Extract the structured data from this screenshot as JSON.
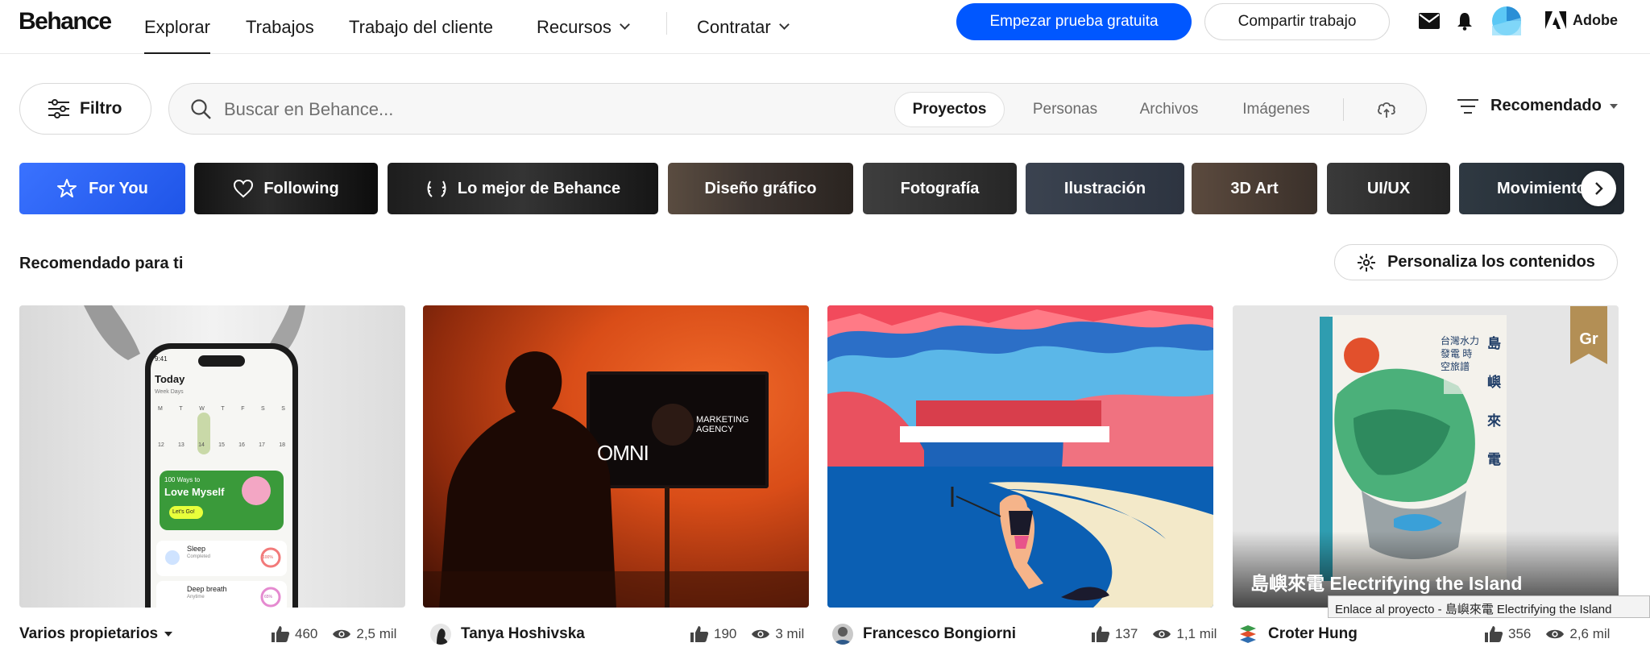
{
  "brand": {
    "logo_text": "Behance",
    "adobe_label": "Adobe",
    "accent": "#0057ff"
  },
  "nav": {
    "explore": "Explorar",
    "jobs": "Trabajos",
    "client_work": "Trabajo del cliente",
    "resources": "Recursos",
    "hire": "Contratar"
  },
  "header_actions": {
    "trial": "Empezar prueba gratuita",
    "share": "Compartir trabajo"
  },
  "filter": {
    "label": "Filtro"
  },
  "search": {
    "placeholder": "Buscar en Behance...",
    "tabs": [
      "Proyectos",
      "Personas",
      "Archivos",
      "Imágenes"
    ],
    "active_tab": "Proyectos"
  },
  "sort": {
    "label": "Recomendado"
  },
  "categories": [
    {
      "label": "For You",
      "active": true
    },
    {
      "label": "Following"
    },
    {
      "label": "Lo mejor de Behance"
    },
    {
      "label": "Diseño gráfico"
    },
    {
      "label": "Fotografía"
    },
    {
      "label": "Ilustración"
    },
    {
      "label": "3D Art"
    },
    {
      "label": "UI/UX"
    },
    {
      "label": "Movimiento"
    }
  ],
  "section": {
    "title": "Recomendado para ti",
    "personalize": "Personaliza los contenidos"
  },
  "projects": [
    {
      "owner": "Varios propietarios",
      "likes": "460",
      "views": "2,5 mil",
      "screen": {
        "title": "Today",
        "subtitle": "Week Days",
        "days": [
          "M",
          "T",
          "W",
          "T",
          "F",
          "S",
          "S"
        ],
        "dates": [
          "12",
          "13",
          "14",
          "15",
          "16",
          "17",
          "18"
        ],
        "card_kicker": "100 Ways to",
        "card_title": "Love Myself",
        "card_button": "Let's Go!",
        "item1": "Sleep",
        "item1_sub": "Completed",
        "item1_pct": "100%",
        "item2": "Deep breath",
        "item2_sub": "Anytime",
        "item2_pct": "65%",
        "time": "9:41"
      }
    },
    {
      "owner": "Tanya Hoshivska",
      "likes": "190",
      "views": "3 mil",
      "screen": {
        "brand": "OMNI",
        "headline": "MARKETING AGENCY"
      }
    },
    {
      "owner": "Francesco Bongiorni",
      "likes": "137",
      "views": "1,1 mil"
    },
    {
      "owner": "Croter Hung",
      "likes": "356",
      "views": "2,6 mil",
      "title": "島嶼來電 Electrifying the Island",
      "badge": "Gr",
      "book_title": "島 嶼 來 電",
      "book_subtitle": "台灣水力發電 時空旅譜"
    }
  ],
  "tooltip": "Enlace al proyecto - 島嶼來電 Electrifying the Island"
}
